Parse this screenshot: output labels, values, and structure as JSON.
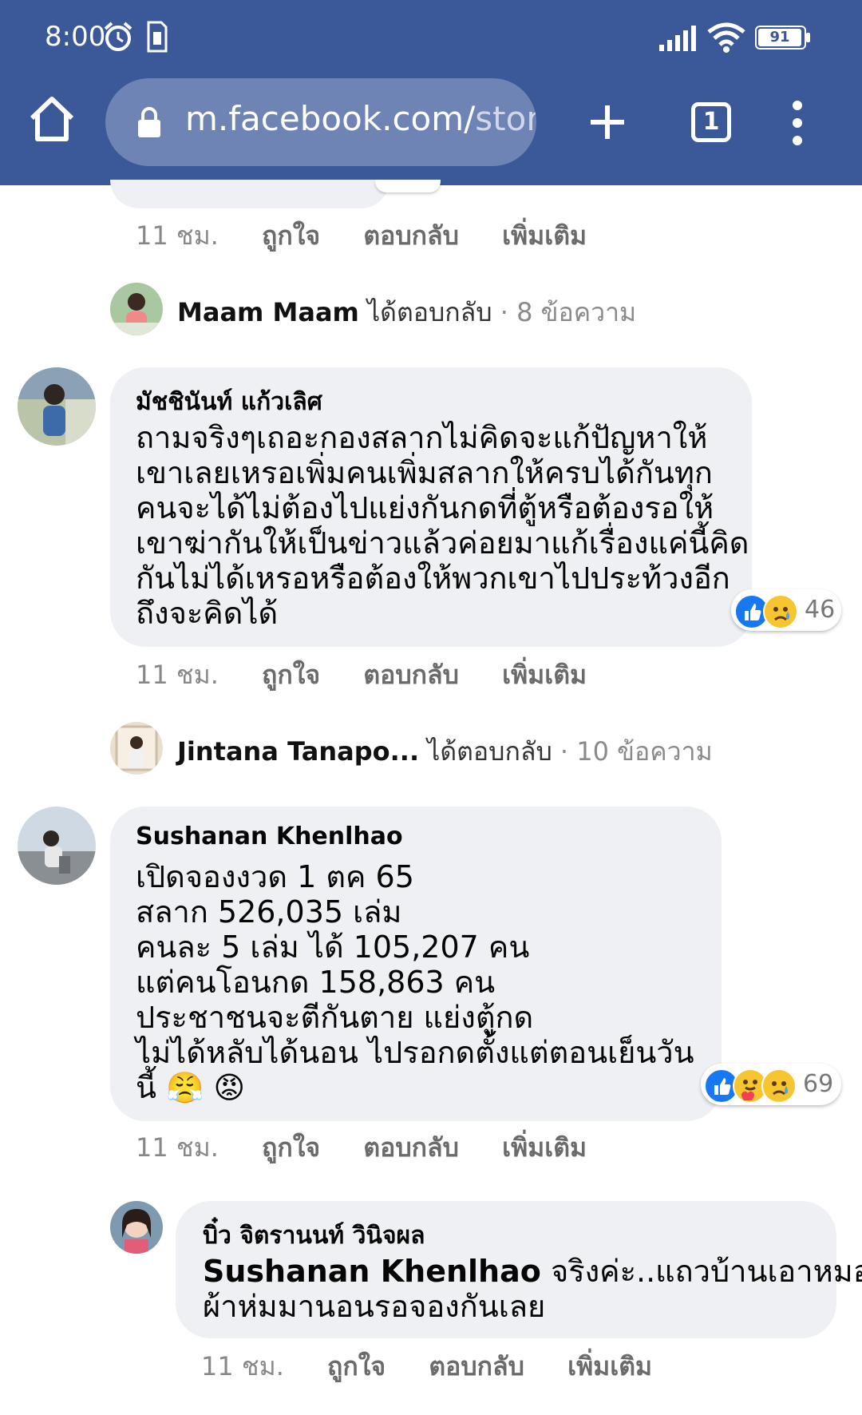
{
  "status_bar": {
    "time": "8:00",
    "battery": "91",
    "icons": [
      "alarm-icon",
      "sim-icon",
      "signal-icon",
      "wifi-icon",
      "battery-icon"
    ]
  },
  "browser": {
    "url_main": "m.facebook.com/",
    "url_dim": "stor",
    "tab_count": "1",
    "icons": [
      "home-icon",
      "lock-icon",
      "plus-icon",
      "tabs-icon",
      "more-vert-icon"
    ]
  },
  "colors": {
    "brand": "#3b5998",
    "bubble_bg": "#eef0f3",
    "like": "#1877f2"
  },
  "labels": {
    "like": "ถูกใจ",
    "reply": "ตอบกลับ",
    "more": "เพิ่มเติม"
  },
  "top_actions": {
    "time": "11 ชม."
  },
  "reply_summary_1": {
    "name": "Maam Maam",
    "verb": "ได้ตอบกลับ",
    "count": "· 8 ข้อความ"
  },
  "comment_1": {
    "author": "มัชชินันท์ แก้วเลิศ",
    "lines": [
      "ถามจริงๆเถอะกองสลากไม่คิดจะแก้ปัญหาให้",
      "เขาเลยเหรอเพิ่มคนเพิ่มสลากให้ครบได้กันทุก",
      "คนจะได้ไม่ต้องไปแย่งกันกดที่ตู้หรือต้องรอให้",
      "เขาฆ่ากันให้เป็นข่าวแล้วค่อยมาแก้เรื่องแค่นี้คิด",
      "กันไม่ได้เหรอหรือต้องให้พวกเขาไปประท้วงอีก",
      "ถึงจะคิดได้"
    ],
    "reactions": "46",
    "time": "11 ชม."
  },
  "reply_summary_2": {
    "name": "Jintana Tanapo...",
    "verb": "ได้ตอบกลับ",
    "count": "· 10 ข้อความ"
  },
  "comment_2": {
    "author": "Sushanan Khenlhao",
    "lines": [
      "เปิดจองงวด 1 ตค 65",
      "สลาก 526,035 เล่ม",
      "คนละ 5 เล่ม ได้ 105,207 คน",
      "แต่คนโอนกด 158,863 คน",
      "ประชาชนจะตีกันตาย แย่งตู้กด",
      "ไม่ได้หลับได้นอน ไปรอกดตั้งแต่ตอนเย็นวัน",
      "นี้ 😤 😡"
    ],
    "reactions": "69",
    "time": "11 ชม."
  },
  "reply_1": {
    "author": "บิ๋ว จิตรานนท์ วินิจผล",
    "tag": "Sushanan Khenlhao",
    "line1_rest": " จริงค่ะ..แถวบ้านเอาหมอน",
    "line2": "ผ้าห่มมานอนรอจองกันเลย",
    "time": "11 ชม."
  }
}
